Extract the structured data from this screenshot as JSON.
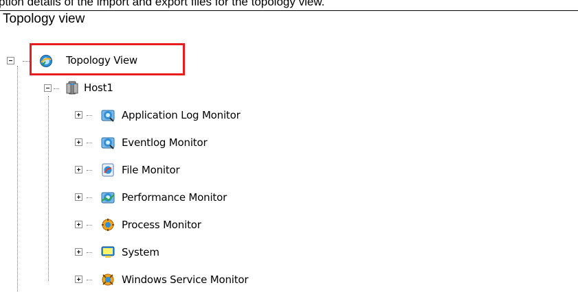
{
  "caption": "ption details of the import and export files for the topology view.",
  "section_title": "Topology view",
  "tree": {
    "root": {
      "label": "Topology View",
      "icon": "topology-icon",
      "expanded": true
    },
    "host": {
      "label": "Host1",
      "icon": "server-icon",
      "expanded": true
    },
    "children": [
      {
        "label": "Application Log Monitor",
        "icon": "monitor-icon"
      },
      {
        "label": "Eventlog Monitor",
        "icon": "monitor-icon"
      },
      {
        "label": "File Monitor",
        "icon": "file-monitor-icon"
      },
      {
        "label": "Performance Monitor",
        "icon": "performance-monitor-icon"
      },
      {
        "label": "Process Monitor",
        "icon": "process-monitor-icon"
      },
      {
        "label": "System",
        "icon": "system-icon"
      },
      {
        "label": "Windows Service Monitor",
        "icon": "windows-service-icon"
      }
    ]
  },
  "colors": {
    "highlight_border": "#e81c1c",
    "tree_lines": "#808080"
  }
}
